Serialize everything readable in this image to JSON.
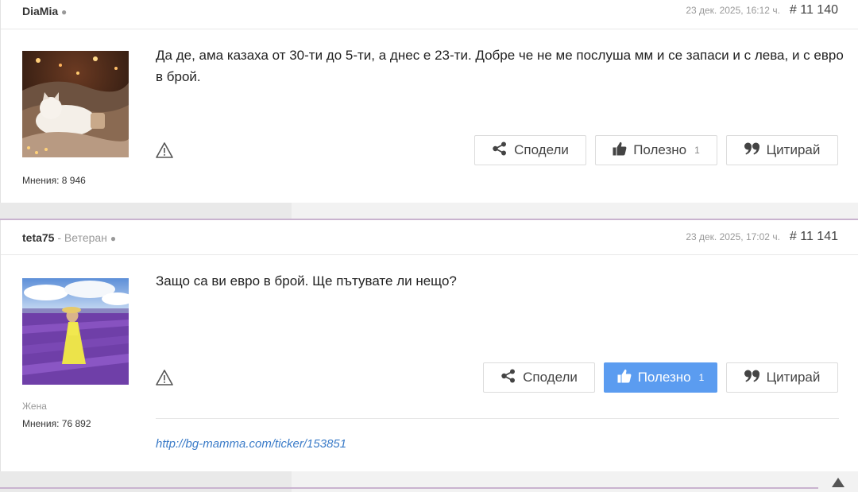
{
  "posts": [
    {
      "author": "DiaMia",
      "rank": "",
      "date": "23 дек. 2025, 16:12 ч.",
      "number": "# 11 140",
      "text": "Да де, ама казаха от 30-ти до 5-ти, а днес е 23-ти. Добре че не ме послуша мм и се запаси и с лева, и с евро в брой.",
      "gender": "",
      "opinions": "Мнения: 8 946",
      "buttons": {
        "share": "Сподели",
        "useful": "Полезно",
        "useful_count": "1",
        "quote": "Цитирай"
      },
      "useful_active": false,
      "link": ""
    },
    {
      "author": "teta75",
      "rank": "- Ветеран",
      "date": "23 дек. 2025, 17:02 ч.",
      "number": "# 11 141",
      "text": "Защо са ви евро в брой. Ще пътувате ли нещо?",
      "gender": "Жена",
      "opinions": "Мнения: 76 892",
      "buttons": {
        "share": "Сподели",
        "useful": "Полезно",
        "useful_count": "1",
        "quote": "Цитирай"
      },
      "useful_active": true,
      "link": "http://bg-mamma.com/ticker/153851"
    }
  ],
  "colors": {
    "accent": "#5b9cf0",
    "link": "#3a7bc8",
    "separator": "#c9b3cf"
  },
  "icons": [
    "online-dot-icon",
    "warning-icon",
    "share-icon",
    "thumbs-up-icon",
    "quote-icon",
    "scroll-top-icon"
  ]
}
